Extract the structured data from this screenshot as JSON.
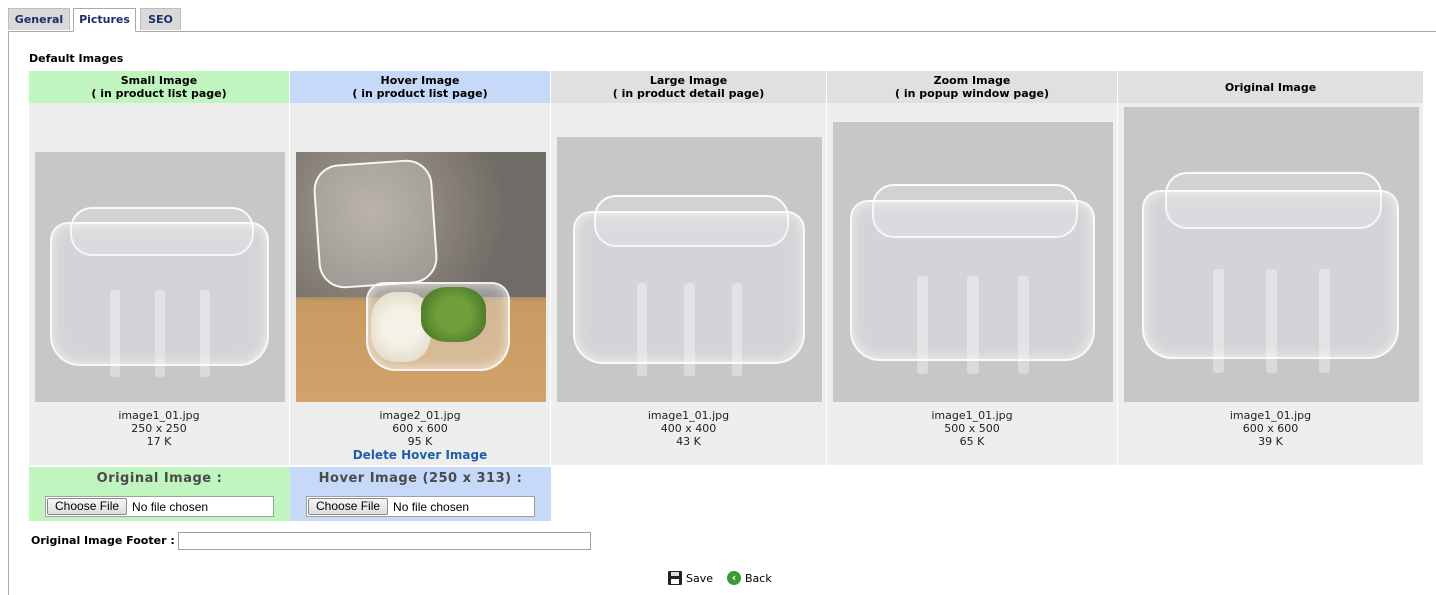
{
  "tabs": [
    {
      "label": "General"
    },
    {
      "label": "Pictures"
    },
    {
      "label": "SEO"
    }
  ],
  "section_title": "Default Images",
  "columns": [
    {
      "title": "Small Image",
      "subtitle": "( in product list page)",
      "file": "image1_01.jpg",
      "dimensions": "250 x 250",
      "size": "17 K",
      "color": "#c0f5c0"
    },
    {
      "title": "Hover Image",
      "subtitle": "( in product list page)",
      "file": "image2_01.jpg",
      "dimensions": "600 x 600",
      "size": "95 K",
      "action": "Delete Hover Image",
      "color": "#c6d9f9"
    },
    {
      "title": "Large Image",
      "subtitle": "( in product detail page)",
      "file": "image1_01.jpg",
      "dimensions": "400 x 400",
      "size": "43 K"
    },
    {
      "title": "Zoom Image",
      "subtitle": "( in popup window page)",
      "file": "image1_01.jpg",
      "dimensions": "500 x 500",
      "size": "65 K"
    },
    {
      "title": "Original Image",
      "file": "image1_01.jpg",
      "dimensions": "600 x 600",
      "size": "39 K"
    }
  ],
  "uploads": {
    "original": {
      "label": "Original Image :",
      "button": "Choose File",
      "status": "No file chosen"
    },
    "hover": {
      "label": "Hover Image (250 x 313) :",
      "button": "Choose File",
      "status": "No file chosen"
    }
  },
  "footer": {
    "label": "Original Image Footer :",
    "value": ""
  },
  "actions": {
    "save": "Save",
    "back": "Back"
  },
  "icons": {
    "save": "floppy-disk-icon",
    "back": "back-arrow-icon"
  }
}
